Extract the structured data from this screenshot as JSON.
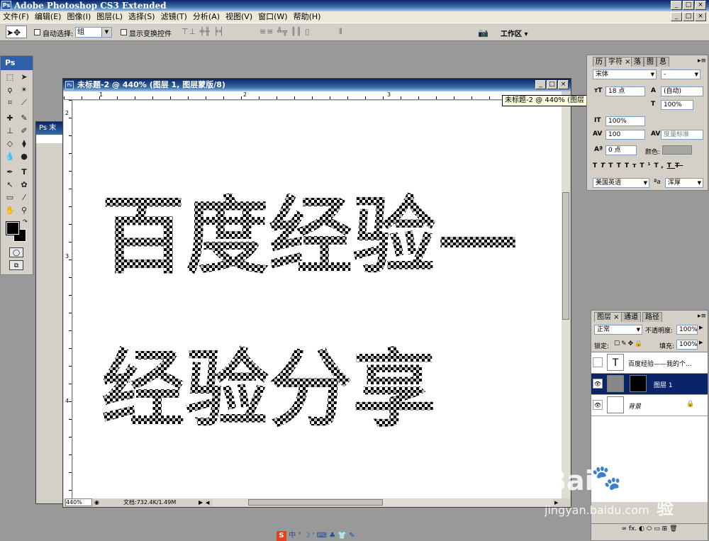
{
  "app": {
    "title": "Adobe Photoshop CS3 Extended",
    "ps_logo": "Ps"
  },
  "window_controls": {
    "min": "_",
    "max": "□",
    "close": "×"
  },
  "menu": [
    "文件(F)",
    "编辑(E)",
    "图像(I)",
    "图层(L)",
    "选择(S)",
    "滤镜(T)",
    "分析(A)",
    "视图(V)",
    "窗口(W)",
    "帮助(H)"
  ],
  "options": {
    "auto_select_label": "自动选择:",
    "auto_select_value": "组",
    "show_transform_label": "显示变换控件",
    "workspace_label": "工作区 ▾"
  },
  "toolbox": {
    "logo": "Ps"
  },
  "document": {
    "title": "未标题-2 @ 440% (图层 1, 图层蒙版/8)",
    "tooltip": "未标题-2 @ 440% (图层 1, 图层蒙版/8)",
    "zoom": "440%",
    "doc_info": "文档:732.4K/1.49M",
    "ruler_h": [
      "1",
      "2",
      "3"
    ],
    "ruler_v": [
      "2",
      "3",
      "4"
    ],
    "canvas_line1": "百度经验—",
    "canvas_line2": "经验分享"
  },
  "char_panel": {
    "tabs": [
      "历",
      "字符 ×",
      "落",
      "图",
      "息"
    ],
    "font_family": "宋体",
    "font_style": "-",
    "font_size": "18 点",
    "leading": "(自动)",
    "vscale": "100%",
    "hscale": "100%",
    "kerning": "度量标准",
    "tracking": "100",
    "baseline": "0 点",
    "color_label": "颜色:",
    "style_buttons": [
      "T",
      "T",
      "TT",
      "Tт",
      "T¹",
      "T,",
      "T",
      "T"
    ],
    "language": "美国英语",
    "aa_label": "ªa",
    "aa_value": "浑厚"
  },
  "layers_panel": {
    "tabs": [
      "图层 ×",
      "通道",
      "路径"
    ],
    "blend_mode": "正常",
    "opacity_label": "不透明度:",
    "opacity_value": "100%",
    "lock_label": "锁定:",
    "fill_label": "填充:",
    "fill_value": "100%",
    "layers": [
      {
        "name": "百度经验——我的个...",
        "type_icon": "T"
      },
      {
        "name": "图层 1"
      },
      {
        "name": "背景"
      }
    ],
    "footer_icons": "∞ fx. ◐ ⬭ ▭ ⊞ 🗑"
  },
  "watermark": {
    "brand": "Bai",
    "paw": "🐾",
    "du": "du",
    "jingyan": "经验",
    "url": "jingyan.baidu.com"
  },
  "ime": {
    "text": "中 ° ☽ ' ⌨ ♣ 👕 ✎",
    "logo": "S"
  }
}
